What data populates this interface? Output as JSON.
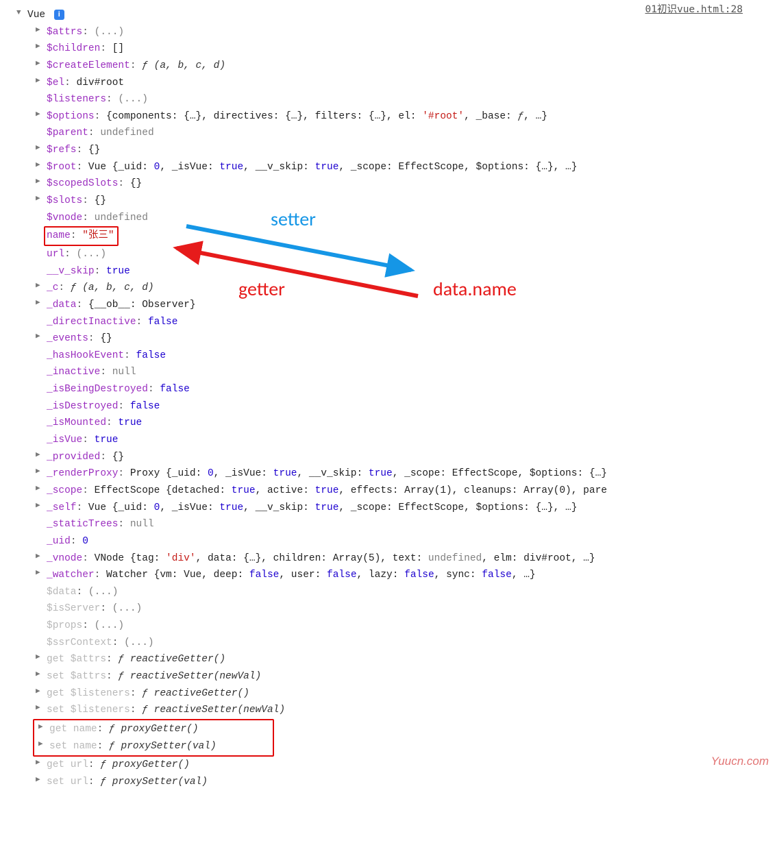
{
  "source_link": "01初识vue.html:28",
  "root_label": "Vue",
  "annotations": {
    "setter": "setter",
    "getter": "getter",
    "dataname": "data.name"
  },
  "watermark": "Yuucn.com",
  "props": {
    "attrs": {
      "key": "$attrs",
      "val": "(...)",
      "arrow": true
    },
    "children": {
      "key": "$children",
      "val": "[]",
      "arrow": true
    },
    "createEl": {
      "key": "$createElement",
      "sig": "(a, b, c, d)",
      "arrow": true
    },
    "el": {
      "key": "$el",
      "val": "div#root",
      "arrow": true
    },
    "listeners": {
      "key": "$listeners",
      "val": "(...)",
      "arrow": false
    },
    "options": {
      "key": "$options",
      "val": "{components: {…}, directives: {…}, filters: {…}, el: '#root', _base: ƒ, …}",
      "arrow": true
    },
    "parent": {
      "key": "$parent",
      "val": "undefined",
      "arrow": false
    },
    "refs": {
      "key": "$refs",
      "val": "{}",
      "arrow": true
    },
    "root": {
      "key": "$root",
      "val": "Vue {_uid: 0, _isVue: true, __v_skip: true, _scope: EffectScope, $options: {…}, …}",
      "arrow": true
    },
    "scopedSlots": {
      "key": "$scopedSlots",
      "val": "{}",
      "arrow": true
    },
    "slots": {
      "key": "$slots",
      "val": "{}",
      "arrow": true
    },
    "vnode": {
      "key": "$vnode",
      "val": "undefined",
      "arrow": false
    },
    "name": {
      "key": "name",
      "val": "\"张三\"",
      "arrow": false
    },
    "url": {
      "key": "url",
      "val": "(...)",
      "arrow": false
    },
    "vskip": {
      "key": "__v_skip",
      "val": "true",
      "arrow": false
    },
    "c": {
      "key": "_c",
      "sig": "(a, b, c, d)",
      "arrow": true
    },
    "data": {
      "key": "_data",
      "val": "{__ob__: Observer}",
      "arrow": true
    },
    "directInactive": {
      "key": "_directInactive",
      "val": "false",
      "arrow": false
    },
    "events": {
      "key": "_events",
      "val": "{}",
      "arrow": true
    },
    "hasHook": {
      "key": "_hasHookEvent",
      "val": "false",
      "arrow": false
    },
    "inactive": {
      "key": "_inactive",
      "val": "null",
      "arrow": false
    },
    "beingDestroyed": {
      "key": "_isBeingDestroyed",
      "val": "false",
      "arrow": false
    },
    "isDestroyed": {
      "key": "_isDestroyed",
      "val": "false",
      "arrow": false
    },
    "isMounted": {
      "key": "_isMounted",
      "val": "true",
      "arrow": false
    },
    "isVue": {
      "key": "_isVue",
      "val": "true",
      "arrow": false
    },
    "provided": {
      "key": "_provided",
      "val": "{}",
      "arrow": true
    },
    "renderProxy": {
      "key": "_renderProxy",
      "val": "Proxy {_uid: 0, _isVue: true, __v_skip: true, _scope: EffectScope, $options: {…}",
      "arrow": true
    },
    "scope": {
      "key": "_scope",
      "val": "EffectScope {detached: true, active: true, effects: Array(1), cleanups: Array(0), pare",
      "arrow": true
    },
    "self": {
      "key": "_self",
      "val": "Vue {_uid: 0, _isVue: true, __v_skip: true, _scope: EffectScope, $options: {…}, …}",
      "arrow": true
    },
    "staticTrees": {
      "key": "_staticTrees",
      "val": "null",
      "arrow": false
    },
    "uid": {
      "key": "_uid",
      "val": "0",
      "arrow": false
    },
    "vnode2": {
      "key": "_vnode",
      "val": "VNode {tag: 'div', data: {…}, children: Array(5), text: undefined, elm: div#root, …}",
      "arrow": true
    },
    "watcher": {
      "key": "_watcher",
      "val": "Watcher {vm: Vue, deep: false, user: false, lazy: false, sync: false, …}",
      "arrow": true
    },
    "pdata": {
      "key": "$data",
      "val": "(...)",
      "arrow": false
    },
    "isServer": {
      "key": "$isServer",
      "val": "(...)",
      "arrow": false
    },
    "pprops": {
      "key": "$props",
      "val": "(...)",
      "arrow": false
    },
    "ssr": {
      "key": "$ssrContext",
      "val": "(...)",
      "arrow": false
    },
    "gAttrs": {
      "key": "get $attrs",
      "sig": "reactiveGetter()",
      "arrow": true
    },
    "sAttrs": {
      "key": "set $attrs",
      "sig": "reactiveSetter(newVal)",
      "arrow": true
    },
    "gList": {
      "key": "get $listeners",
      "sig": "reactiveGetter()",
      "arrow": true
    },
    "sList": {
      "key": "set $listeners",
      "sig": "reactiveSetter(newVal)",
      "arrow": true
    },
    "gName": {
      "key": "get name",
      "sig": "proxyGetter()",
      "arrow": true
    },
    "sName": {
      "key": "set name",
      "sig": "proxySetter(val)",
      "arrow": true
    },
    "gUrl": {
      "key": "get url",
      "sig": "proxyGetter()",
      "arrow": true
    },
    "sUrl": {
      "key": "set url",
      "sig": "proxySetter(val)",
      "arrow": true
    }
  }
}
